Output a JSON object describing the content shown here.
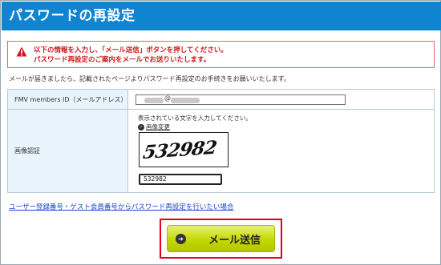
{
  "header": {
    "title": "パスワードの再設定"
  },
  "alert": {
    "line1": "以下の情報を入力し、「メール送信」ボタンを押してください。",
    "line2": "パスワード再設定のご案内をメールでお送りいたします。",
    "icon": "warning-icon",
    "color": "#d0171b"
  },
  "intro": "メールが届きましたら、記載されたページよりパスワード再設定のお手続きをお願いいたします。",
  "form": {
    "email_label": "FMV members ID（メールアドレス）",
    "email_at": "@",
    "captcha_label": "画像認証",
    "captcha_hint": "表示されている文字を入力してください。",
    "captcha_change": "画像変更",
    "captcha_image_text": "532982",
    "captcha_value": "532982"
  },
  "alt_link": "ユーザー登録番号・ゲスト会員番号からパスワード再設定を行いたい場合",
  "submit": {
    "label": "メール送信",
    "icon": "arrow-right-circle-icon"
  },
  "colors": {
    "header": "#0f84d1",
    "button": "#c4d800",
    "highlight": "#e2001a"
  }
}
